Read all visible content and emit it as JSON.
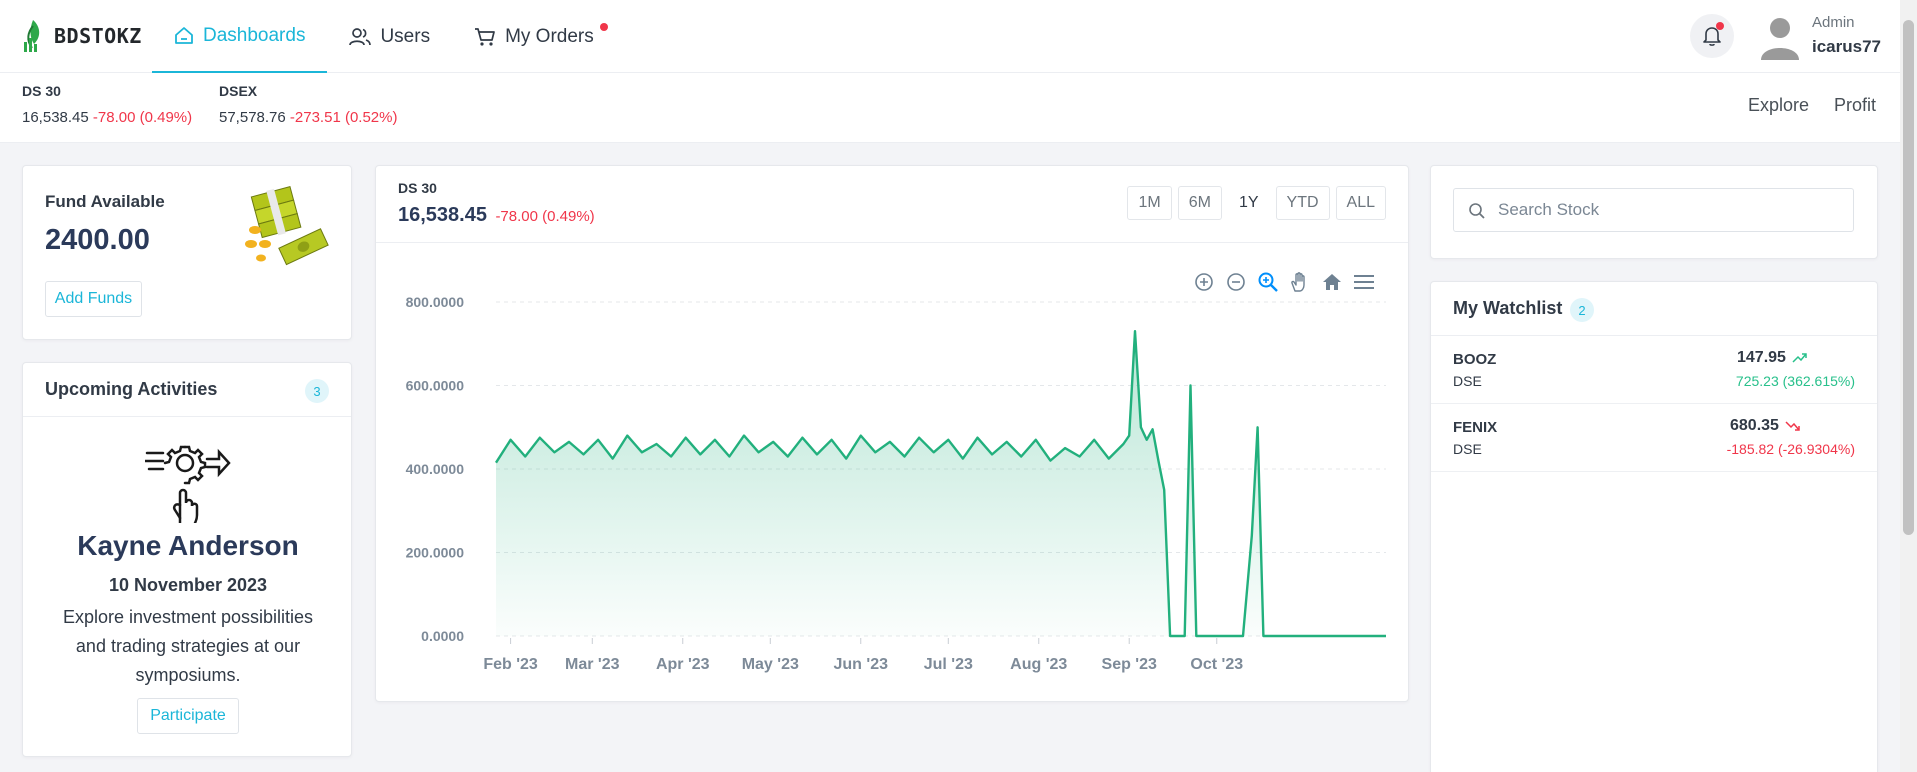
{
  "brand": {
    "name": "BDSTOKZ"
  },
  "nav": [
    {
      "label": "Dashboards",
      "icon": "home-icon",
      "active": true
    },
    {
      "label": "Users",
      "icon": "users-icon"
    },
    {
      "label": "My Orders",
      "icon": "cart-icon",
      "has_notification_dot": true
    }
  ],
  "user": {
    "role": "Admin",
    "name": "icarus77"
  },
  "indices": [
    {
      "name": "DS 30",
      "value": "16,538.45",
      "change": "-78.00 (0.49%)"
    },
    {
      "name": "DSEX",
      "value": "57,578.76",
      "change": "-273.51 (0.52%)"
    }
  ],
  "header_links": [
    "Explore",
    "Profit"
  ],
  "fund": {
    "label": "Fund Available",
    "amount": "2400.00",
    "button": "Add Funds"
  },
  "activities": {
    "title": "Upcoming Activities",
    "count": "3",
    "name": "Kayne Anderson",
    "date": "10 November 2023",
    "description": "Explore investment possibilities and trading strategies at our symposiums.",
    "button": "Participate"
  },
  "chart_panel": {
    "name": "DS 30",
    "value": "16,538.45",
    "change": "-78.00 (0.49%)",
    "ranges": [
      "1M",
      "6M",
      "1Y",
      "YTD",
      "ALL"
    ],
    "active_range": "1Y",
    "toolbar": [
      "zoom-in-icon",
      "zoom-out-icon",
      "selection-zoom-icon",
      "pan-hand-icon",
      "reset-home-icon",
      "menu-icon"
    ]
  },
  "chart_data": {
    "type": "area",
    "xlabel": "",
    "ylabel": "",
    "x_tick_labels": [
      "Feb '23",
      "Mar '23",
      "Apr '23",
      "May '23",
      "Jun '23",
      "Jul '23",
      "Aug '23",
      "Sep '23",
      "Oct '23"
    ],
    "y_tick_labels": [
      "0.0000",
      "200.0000",
      "400.0000",
      "600.0000",
      "800.0000"
    ],
    "ylim": [
      0,
      800
    ],
    "x_range": [
      "2023-01-27",
      "2023-11-28"
    ],
    "grid": true,
    "color": "#22b07d",
    "series": [
      {
        "values": [
          [
            "2023-01-27",
            415
          ],
          [
            "2023-02-01",
            470
          ],
          [
            "2023-02-06",
            430
          ],
          [
            "2023-02-11",
            475
          ],
          [
            "2023-02-16",
            440
          ],
          [
            "2023-02-21",
            465
          ],
          [
            "2023-02-26",
            435
          ],
          [
            "2023-03-03",
            470
          ],
          [
            "2023-03-08",
            425
          ],
          [
            "2023-03-13",
            480
          ],
          [
            "2023-03-18",
            440
          ],
          [
            "2023-03-23",
            460
          ],
          [
            "2023-03-28",
            430
          ],
          [
            "2023-04-02",
            475
          ],
          [
            "2023-04-07",
            435
          ],
          [
            "2023-04-12",
            470
          ],
          [
            "2023-04-17",
            430
          ],
          [
            "2023-04-22",
            480
          ],
          [
            "2023-04-27",
            440
          ],
          [
            "2023-05-02",
            465
          ],
          [
            "2023-05-07",
            430
          ],
          [
            "2023-05-12",
            475
          ],
          [
            "2023-05-17",
            435
          ],
          [
            "2023-05-22",
            470
          ],
          [
            "2023-05-27",
            425
          ],
          [
            "2023-06-01",
            480
          ],
          [
            "2023-06-06",
            440
          ],
          [
            "2023-06-11",
            465
          ],
          [
            "2023-06-16",
            430
          ],
          [
            "2023-06-21",
            475
          ],
          [
            "2023-06-26",
            440
          ],
          [
            "2023-07-01",
            470
          ],
          [
            "2023-07-06",
            425
          ],
          [
            "2023-07-11",
            475
          ],
          [
            "2023-07-16",
            435
          ],
          [
            "2023-07-21",
            465
          ],
          [
            "2023-07-26",
            430
          ],
          [
            "2023-07-31",
            470
          ],
          [
            "2023-08-05",
            420
          ],
          [
            "2023-08-10",
            450
          ],
          [
            "2023-08-15",
            430
          ],
          [
            "2023-08-20",
            470
          ],
          [
            "2023-08-25",
            425
          ],
          [
            "2023-08-30",
            460
          ],
          [
            "2023-09-01",
            480
          ],
          [
            "2023-09-03",
            730
          ],
          [
            "2023-09-05",
            500
          ],
          [
            "2023-09-07",
            470
          ],
          [
            "2023-09-09",
            495
          ],
          [
            "2023-09-11",
            420
          ],
          [
            "2023-09-13",
            350
          ],
          [
            "2023-09-15",
            0
          ],
          [
            "2023-09-20",
            0
          ],
          [
            "2023-09-22",
            600
          ],
          [
            "2023-09-24",
            0
          ],
          [
            "2023-10-10",
            0
          ],
          [
            "2023-10-13",
            240
          ],
          [
            "2023-10-15",
            500
          ],
          [
            "2023-10-17",
            0
          ],
          [
            "2023-11-28",
            0
          ]
        ]
      }
    ]
  },
  "search": {
    "placeholder": "Search Stock"
  },
  "watchlist": {
    "title": "My Watchlist",
    "count": "2",
    "items": [
      {
        "symbol": "BOOZ",
        "exchange": "DSE",
        "price": "147.95",
        "change": "725.23 (362.615%)",
        "direction": "up"
      },
      {
        "symbol": "FENIX",
        "exchange": "DSE",
        "price": "680.35",
        "change": "-185.82 (-26.9304%)",
        "direction": "down"
      }
    ]
  }
}
